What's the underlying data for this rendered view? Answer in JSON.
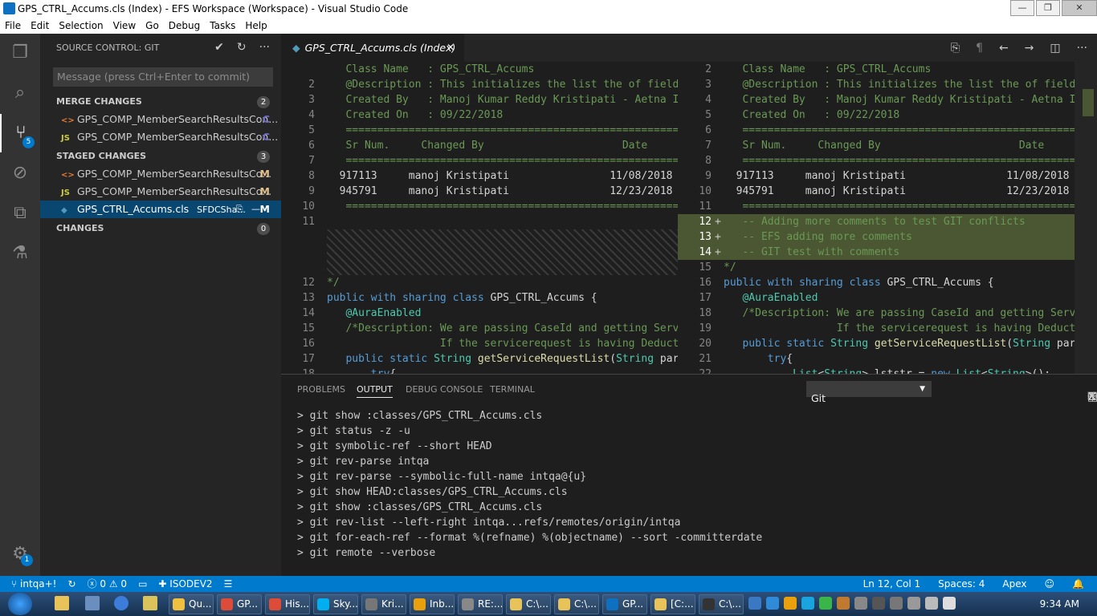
{
  "window": {
    "title": "GPS_CTRL_Accums.cls (Index) - EFS Workspace (Workspace) - Visual Studio Code"
  },
  "menu": [
    "File",
    "Edit",
    "Selection",
    "View",
    "Go",
    "Debug",
    "Tasks",
    "Help"
  ],
  "activity": {
    "scm_badge": "5",
    "settings_badge": "1"
  },
  "sidebar": {
    "title": "SOURCE CONTROL: GIT",
    "message_placeholder": "Message (press Ctrl+Enter to commit)",
    "merge": {
      "label": "MERGE CHANGES",
      "count": "2",
      "items": [
        {
          "name": "GPS_COMP_MemberSearchResultsCon...",
          "status": "C",
          "type": "<>"
        },
        {
          "name": "GPS_COMP_MemberSearchResultsCon...",
          "status": "C",
          "type": "JS"
        }
      ]
    },
    "staged": {
      "label": "STAGED CHANGES",
      "count": "3",
      "items": [
        {
          "name": "GPS_COMP_MemberSearchResultsCo...",
          "status": "M",
          "type": "<>"
        },
        {
          "name": "GPS_COMP_MemberSearchResultsCo...",
          "status": "M",
          "type": "JS"
        },
        {
          "name": "GPS_CTRL_Accums.cls",
          "folder": "SFDCSha...",
          "status": "M",
          "type": "◆"
        }
      ]
    },
    "changes": {
      "label": "CHANGES",
      "count": "0"
    }
  },
  "editor": {
    "tab": "GPS_CTRL_Accums.cls (Index)",
    "left": [
      {
        "n": "",
        "t": "   Class Name   : GPS_CTRL_Accums",
        "c": "cm"
      },
      {
        "n": "2",
        "t": "   @Description : This initializes the list the of field",
        "c": "cm"
      },
      {
        "n": "3",
        "t": "   Created By   : Manoj Kumar Reddy Kristipati - Aetna I",
        "c": "cm"
      },
      {
        "n": "4",
        "t": "   Created On   : 09/22/2018",
        "c": "cm"
      },
      {
        "n": "5",
        "t": "   ============================================================",
        "c": "cm"
      },
      {
        "n": "6",
        "t": "   Sr Num.     Changed By                      Date",
        "c": "cm"
      },
      {
        "n": "7",
        "t": "   ============================================================",
        "c": "cm"
      },
      {
        "n": "8",
        "t": "  917113     manoj Kristipati                11/08/2018",
        "c": ""
      },
      {
        "n": "9",
        "t": "  945791     manoj Kristipati                12/23/2018",
        "c": ""
      },
      {
        "n": "10",
        "t": "   ============================================================",
        "c": "cm"
      },
      {
        "n": "11",
        "t": "",
        "c": "hatch"
      },
      {
        "n": "12",
        "t": "*/",
        "c": "cm"
      },
      {
        "n": "13",
        "t": "public with sharing class GPS_CTRL_Accums {",
        "c": ""
      },
      {
        "n": "14",
        "t": "   @AuraEnabled",
        "c": "an"
      },
      {
        "n": "15",
        "t": "   /*Description: We are passing CaseId and getting Serv",
        "c": "cm"
      },
      {
        "n": "16",
        "t": "                  If the servicerequest is having Deduct",
        "c": "cm"
      },
      {
        "n": "17",
        "t": "   public static String getServiceRequestList(String par",
        "c": ""
      },
      {
        "n": "18",
        "t": "       try{",
        "c": ""
      },
      {
        "n": "19",
        "t": "           List<String> lststr = new List<String>();",
        "c": ""
      }
    ],
    "right": [
      {
        "n": "2",
        "t": "   Class Name   : GPS_CTRL_Accums",
        "c": "cm"
      },
      {
        "n": "3",
        "t": "   @Description : This initializes the list the of field",
        "c": "cm"
      },
      {
        "n": "4",
        "t": "   Created By   : Manoj Kumar Reddy Kristipati - Aetna I",
        "c": "cm"
      },
      {
        "n": "5",
        "t": "   Created On   : 09/22/2018",
        "c": "cm"
      },
      {
        "n": "6",
        "t": "   ============================================================",
        "c": "cm"
      },
      {
        "n": "7",
        "t": "   Sr Num.     Changed By                      Date",
        "c": "cm"
      },
      {
        "n": "8",
        "t": "   ============================================================",
        "c": "cm"
      },
      {
        "n": "9",
        "t": "  917113     manoj Kristipati                11/08/2018",
        "c": ""
      },
      {
        "n": "10",
        "t": "  945791     manoj Kristipati                12/23/2018",
        "c": ""
      },
      {
        "n": "11",
        "t": "   ============================================================",
        "c": "cm"
      },
      {
        "n": "12",
        "t": "   -- Adding more comments to test GIT conflicts",
        "c": "add"
      },
      {
        "n": "13",
        "t": "   -- EFS adding more comments",
        "c": "add"
      },
      {
        "n": "14",
        "t": "   -- GIT test with comments",
        "c": "add"
      },
      {
        "n": "15",
        "t": "*/",
        "c": "cm"
      },
      {
        "n": "16",
        "t": "public with sharing class GPS_CTRL_Accums {",
        "c": ""
      },
      {
        "n": "17",
        "t": "   @AuraEnabled",
        "c": "an"
      },
      {
        "n": "18",
        "t": "   /*Description: We are passing CaseId and getting Serv",
        "c": "cm"
      },
      {
        "n": "19",
        "t": "                  If the servicerequest is having Deduct",
        "c": "cm"
      },
      {
        "n": "20",
        "t": "   public static String getServiceRequestList(String par",
        "c": ""
      },
      {
        "n": "21",
        "t": "       try{",
        "c": ""
      },
      {
        "n": "22",
        "t": "           List<String> lststr = new List<String>();",
        "c": ""
      }
    ]
  },
  "panel": {
    "tabs": [
      "PROBLEMS",
      "OUTPUT",
      "DEBUG CONSOLE",
      "TERMINAL"
    ],
    "channel": "Git",
    "lines": [
      "> git show :classes/GPS_CTRL_Accums.cls",
      "> git status -z -u",
      "> git symbolic-ref --short HEAD",
      "> git rev-parse intqa",
      "> git rev-parse --symbolic-full-name intqa@{u}",
      "> git show HEAD:classes/GPS_CTRL_Accums.cls",
      "> git show :classes/GPS_CTRL_Accums.cls",
      "> git rev-list --left-right intqa...refs/remotes/origin/intqa",
      "> git for-each-ref --format %(refname) %(objectname) --sort -committerdate",
      "> git remote --verbose"
    ]
  },
  "status": {
    "branch": "intqa+!",
    "errors": "0",
    "warnings": "0",
    "org": "ISODEV2",
    "position": "Ln 12, Col 1",
    "spaces": "Spaces: 4",
    "language": "Apex"
  },
  "taskbar": {
    "items": [
      "Qu...",
      "GP...",
      "His...",
      "Sky...",
      "Kri...",
      "Inb...",
      "RE:...",
      "C:\\...",
      "C:\\...",
      "GP...",
      "[C:...",
      "C:\\..."
    ],
    "time": "9:34 AM"
  }
}
